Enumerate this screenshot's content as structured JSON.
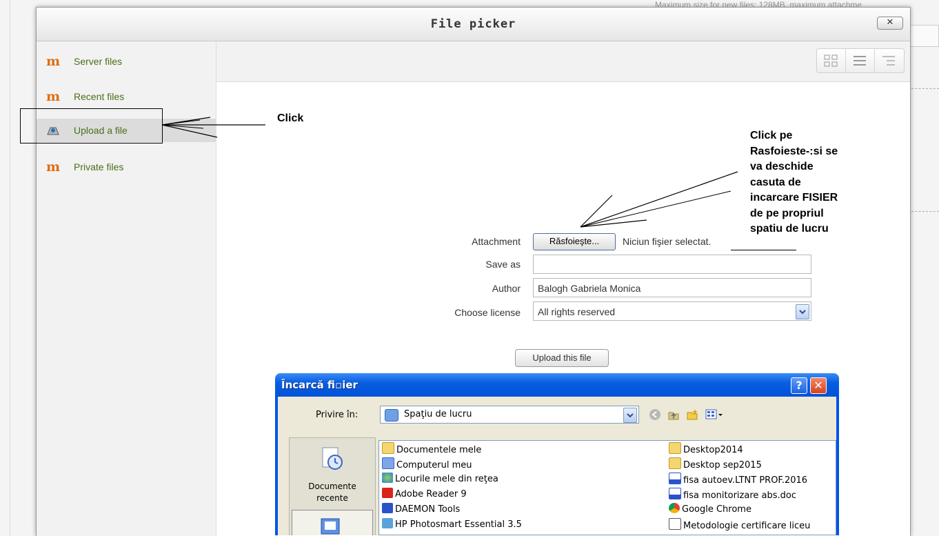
{
  "background": {
    "top_text": "Maximum size for new files: 128MB, maximum attachme"
  },
  "dialog": {
    "title": "File picker",
    "close_label": "✕"
  },
  "sidebar": {
    "items": [
      {
        "label": "Server files",
        "icon": "moodle-icon"
      },
      {
        "label": "Recent files",
        "icon": "moodle-icon"
      },
      {
        "label": "Upload a file",
        "icon": "upload-icon",
        "selected": true
      },
      {
        "label": "Private files",
        "icon": "moodle-icon"
      }
    ]
  },
  "form": {
    "attachment_label": "Attachment",
    "browse_button": "Răsfoieşte...",
    "no_file_text": "Niciun fişier selectat.",
    "save_as_label": "Save as",
    "save_as_value": "",
    "author_label": "Author",
    "author_value": "Balogh Gabriela Monica",
    "license_label": "Choose license",
    "license_value": "All rights reserved",
    "upload_button": "Upload this file"
  },
  "annotations": {
    "click": "Click",
    "browse_note": [
      "Click pe",
      "Rasfoieste-:si se",
      "va deschide",
      "casuta de",
      "incarcare FISIER",
      "de pe propriul",
      "spatiu de lucru"
    ]
  },
  "upload_dialog": {
    "title": "Încarcă fi▫ier",
    "help_label": "?",
    "close_label": "✕",
    "look_in_label": "Privire în:",
    "look_in_value": "Spaţiu de lucru",
    "places": [
      {
        "label": "Documente\nrecente",
        "icon": "recent-documents-icon"
      }
    ],
    "files_left": [
      {
        "name": "Documentele mele",
        "icon": "folder-icon"
      },
      {
        "name": "Computerul meu",
        "icon": "computer-icon"
      },
      {
        "name": "Locurile mele din reţea",
        "icon": "network-icon"
      },
      {
        "name": "Adobe Reader 9",
        "icon": "adobe-icon"
      },
      {
        "name": "DAEMON Tools",
        "icon": "daemon-icon"
      },
      {
        "name": "HP Photosmart Essential 3.5",
        "icon": "hp-icon"
      }
    ],
    "files_right": [
      {
        "name": "Desktop2014",
        "icon": "folder-shortcut-icon"
      },
      {
        "name": "Desktop sep2015",
        "icon": "folder-shortcut-icon"
      },
      {
        "name": "fisa autoev.LTNT PROF.2016",
        "icon": "word-doc-icon"
      },
      {
        "name": "fisa monitorizare abs.doc",
        "icon": "word-doc-icon"
      },
      {
        "name": "Google Chrome",
        "icon": "chrome-icon"
      },
      {
        "name": "Metodologie certificare liceu",
        "icon": "doc-icon"
      }
    ]
  },
  "colors": {
    "sidebar_link": "#486f17",
    "moodle_orange": "#e06d0f",
    "xp_blue": "#0055e5",
    "xp_close": "#e0502a"
  }
}
